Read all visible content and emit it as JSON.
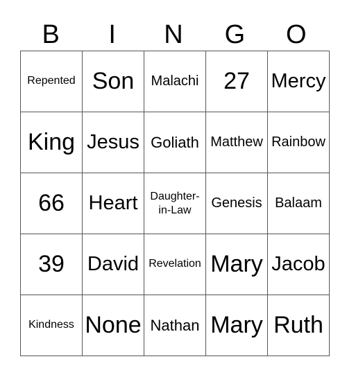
{
  "header": [
    "B",
    "I",
    "N",
    "G",
    "O"
  ],
  "rows": [
    [
      {
        "text": "Repented",
        "size": "xs"
      },
      {
        "text": "Son",
        "size": "xl"
      },
      {
        "text": "Malachi",
        "size": "sm"
      },
      {
        "text": "27",
        "size": "num"
      },
      {
        "text": "Mercy",
        "size": "lg"
      }
    ],
    [
      {
        "text": "King",
        "size": "xl"
      },
      {
        "text": "Jesus",
        "size": "lg"
      },
      {
        "text": "Goliath",
        "size": "md"
      },
      {
        "text": "Matthew",
        "size": "sm"
      },
      {
        "text": "Rainbow",
        "size": "sm"
      }
    ],
    [
      {
        "text": "66",
        "size": "num"
      },
      {
        "text": "Heart",
        "size": "lg"
      },
      {
        "text": "Daughter-\nin-Law",
        "size": "2line"
      },
      {
        "text": "Genesis",
        "size": "sm"
      },
      {
        "text": "Balaam",
        "size": "sm"
      }
    ],
    [
      {
        "text": "39",
        "size": "num"
      },
      {
        "text": "David",
        "size": "lg"
      },
      {
        "text": "Revelation",
        "size": "xs"
      },
      {
        "text": "Mary",
        "size": "xl"
      },
      {
        "text": "Jacob",
        "size": "lg"
      }
    ],
    [
      {
        "text": "Kindness",
        "size": "xs"
      },
      {
        "text": "None",
        "size": "xl"
      },
      {
        "text": "Nathan",
        "size": "md"
      },
      {
        "text": "Mary",
        "size": "xl"
      },
      {
        "text": "Ruth",
        "size": "xl"
      }
    ]
  ]
}
